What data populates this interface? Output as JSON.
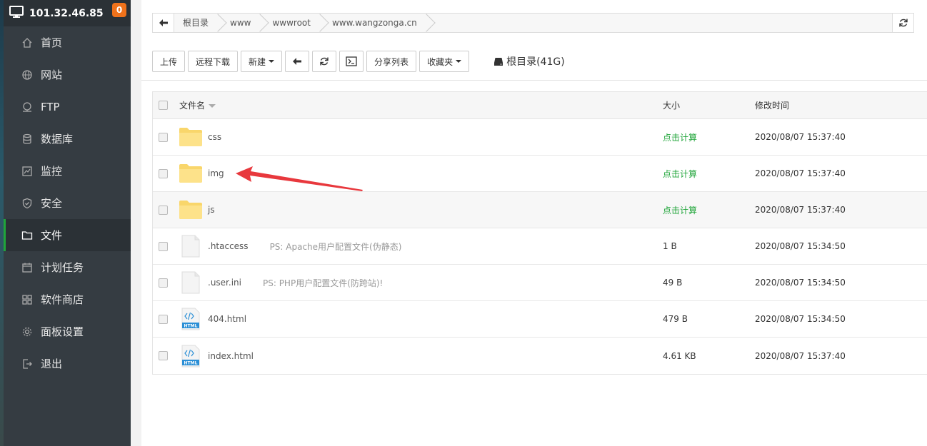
{
  "sidebar": {
    "server_ip": "101.32.46.85",
    "notification_count": "0",
    "items": [
      {
        "label": "首页",
        "icon": "home-icon"
      },
      {
        "label": "网站",
        "icon": "globe-icon"
      },
      {
        "label": "FTP",
        "icon": "ftp-icon"
      },
      {
        "label": "数据库",
        "icon": "database-icon"
      },
      {
        "label": "监控",
        "icon": "monitor-icon"
      },
      {
        "label": "安全",
        "icon": "shield-icon"
      },
      {
        "label": "文件",
        "icon": "folder-icon",
        "active": true
      },
      {
        "label": "计划任务",
        "icon": "calendar-icon"
      },
      {
        "label": "软件商店",
        "icon": "grid-icon"
      },
      {
        "label": "面板设置",
        "icon": "gear-icon"
      },
      {
        "label": "退出",
        "icon": "logout-icon"
      }
    ]
  },
  "breadcrumb": [
    "根目录",
    "www",
    "wwwroot",
    "www.wangzonga.cn"
  ],
  "toolbar": {
    "upload": "上传",
    "remote_download": "远程下载",
    "new": "新建",
    "share_list": "分享列表",
    "favorites": "收藏夹",
    "disk_label": "根目录(41G)"
  },
  "table": {
    "headers": {
      "name": "文件名",
      "size": "大小",
      "modified": "修改时间"
    },
    "rows": [
      {
        "type": "folder",
        "name": "css",
        "note": "",
        "size": "点击计算",
        "time": "2020/08/07 15:37:40"
      },
      {
        "type": "folder",
        "name": "img",
        "note": "",
        "size": "点击计算",
        "time": "2020/08/07 15:37:40"
      },
      {
        "type": "folder",
        "name": "js",
        "note": "",
        "size": "点击计算",
        "time": "2020/08/07 15:37:40"
      },
      {
        "type": "file",
        "name": ".htaccess",
        "note": "PS: Apache用户配置文件(伪静态)",
        "size": "1 B",
        "time": "2020/08/07 15:34:50"
      },
      {
        "type": "file",
        "name": ".user.ini",
        "note": "PS: PHP用户配置文件(防跨站)!",
        "size": "49 B",
        "time": "2020/08/07 15:34:50"
      },
      {
        "type": "html",
        "name": "404.html",
        "note": "",
        "size": "479 B",
        "time": "2020/08/07 15:34:50"
      },
      {
        "type": "html",
        "name": "index.html",
        "note": "",
        "size": "4.61 KB",
        "time": "2020/08/07 15:37:40"
      }
    ]
  },
  "colors": {
    "accent": "#20a53a",
    "sidebar": "#353c42",
    "badge": "#f0721b",
    "annotation_arrow": "#e8383d"
  }
}
